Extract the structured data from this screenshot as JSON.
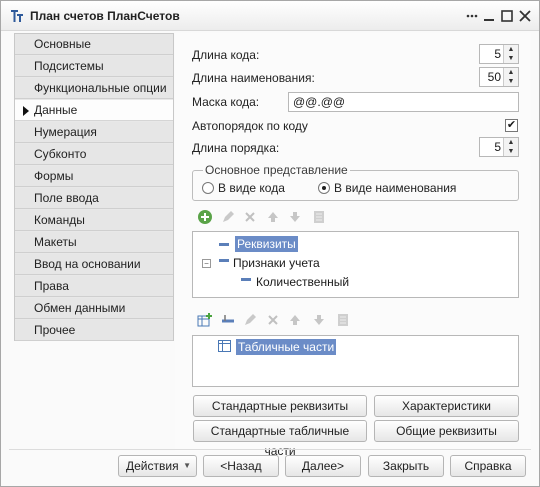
{
  "window": {
    "title": "План счетов ПланСчетов"
  },
  "tabs": [
    {
      "label": "Основные"
    },
    {
      "label": "Подсистемы"
    },
    {
      "label": "Функциональные опции"
    },
    {
      "label": "Данные",
      "active": true
    },
    {
      "label": "Нумерация"
    },
    {
      "label": "Субконто"
    },
    {
      "label": "Формы"
    },
    {
      "label": "Поле ввода"
    },
    {
      "label": "Команды"
    },
    {
      "label": "Макеты"
    },
    {
      "label": "Ввод на основании"
    },
    {
      "label": "Права"
    },
    {
      "label": "Обмен данными"
    },
    {
      "label": "Прочее"
    }
  ],
  "fields": {
    "code_length_label": "Длина кода:",
    "code_length_value": "5",
    "name_length_label": "Длина наименования:",
    "name_length_value": "50",
    "code_mask_label": "Маска кода:",
    "code_mask_value": "@@.@@",
    "auto_order_label": "Автопорядок по коду",
    "auto_order_checked": "✔",
    "order_length_label": "Длина порядка:",
    "order_length_value": "5"
  },
  "representation": {
    "title": "Основное представление",
    "option_code": "В виде кода",
    "option_name": "В виде наименования",
    "selected": "name"
  },
  "attributes_tree": {
    "root": "Реквизиты",
    "flags": "Признаки учета",
    "flag_child": "Количественный"
  },
  "tabular_tree": {
    "root": "Табличные части"
  },
  "buttons": {
    "standard_attrs": "Стандартные реквизиты",
    "characteristics": "Характеристики",
    "standard_tabular": "Стандартные табличные части",
    "common_attrs": "Общие реквизиты"
  },
  "footer": {
    "actions": "Действия",
    "back": "<Назад",
    "next": "Далее>",
    "close": "Закрыть",
    "help": "Справка"
  }
}
